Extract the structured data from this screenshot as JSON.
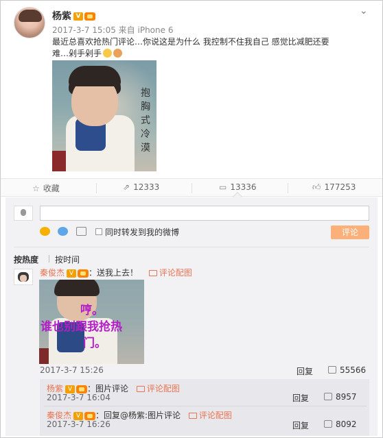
{
  "post": {
    "username": "杨紫",
    "meta": "2017-3-7 15:05 来自 iPhone 6",
    "text": "最近总喜欢抢热门评论…你说这是为什么 我控制不住我自己 感觉比减肥还要难…剁手剁手",
    "image_caption": [
      "抱",
      "胸",
      "式",
      "冷",
      "漠"
    ]
  },
  "actions": {
    "favorite": "收藏",
    "repost_count": "12333",
    "comment_count": "13336",
    "like_count": "177253"
  },
  "composer": {
    "input_value": "",
    "also_repost_label": "同时转发到我的微博",
    "submit_label": "评论"
  },
  "sort": {
    "by_hot": "按热度",
    "by_time": "按时间"
  },
  "comments": [
    {
      "author": "秦俊杰",
      "text": "：送我上去！",
      "image_link": "评论配图",
      "image_text_line1": "哼。",
      "image_text_line2": "谁也别跟我抢热",
      "image_text_line3": "门。",
      "time": "2017-3-7 15:26",
      "reply_label": "回复",
      "likes": "55566"
    }
  ],
  "replies": [
    {
      "author": "杨紫",
      "text": "：图片评论",
      "image_link": "评论配图",
      "time": "2017-3-7 16:04",
      "reply_label": "回复",
      "likes": "8957"
    },
    {
      "author": "秦俊杰",
      "text": "：回复@杨紫:图片评论",
      "image_link": "评论配图",
      "time": "2017-3-7 16:26",
      "reply_label": "回复",
      "likes": "8092"
    }
  ],
  "colors": {
    "accent_orange": "#eb7350",
    "submit_button": "#fbb07a",
    "comment_panel": "#f2f2f5",
    "image_overlay_text": "#b31ec7"
  }
}
